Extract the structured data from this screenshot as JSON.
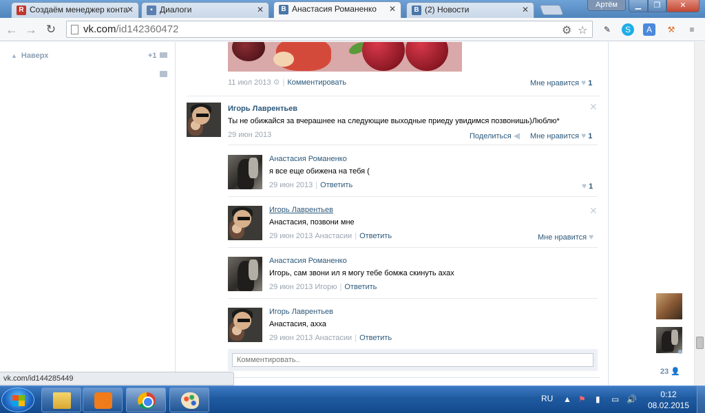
{
  "browser": {
    "tabs": [
      {
        "title": "Создаём менеджер конта",
        "icon": "R"
      },
      {
        "title": "Диалоги",
        "icon": ""
      },
      {
        "title": "Анастасия Романенко",
        "icon": "B"
      },
      {
        "title": "(2) Новости",
        "icon": "B"
      }
    ],
    "user": "Артём",
    "url_host": "vk.com",
    "url_path": "/id142360472",
    "status_url": "vk.com/id144285449"
  },
  "sidebar": {
    "go_up": "Наверх",
    "notif_count": "+1"
  },
  "post": {
    "date": "11 июл 2013",
    "comment_link": "Комментировать",
    "like_label": "Мне нравится",
    "like_count": "1"
  },
  "wall_post": {
    "author": "Игорь Лаврентьев",
    "text": "Ты не обижайся за вчерашнее на следующие выходные приеду увидимся позвонишь)Люблю*",
    "date": "29 июн 2013",
    "share_label": "Поделиться",
    "like_label": "Мне нравится",
    "like_count": "1"
  },
  "replies": [
    {
      "author": "Анастасия Романенко",
      "text": "я все еще обижена на тебя (",
      "date": "29 июн 2013",
      "reply_link": "Ответить",
      "like_count": "1"
    },
    {
      "author": "Игорь Лаврентьев",
      "text": "Анастасия, позвони мне",
      "date": "29 июн 2013 Анастасии",
      "reply_link": "Ответить",
      "like_label": "Мне нравится"
    },
    {
      "author": "Анастасия Романенко",
      "text": "Игорь, сам звони ил я могу тебе бомжа скинуть ахах",
      "date": "29 июн 2013 Игорю",
      "reply_link": "Ответить"
    },
    {
      "author": "Игорь Лаврентьев",
      "text": "Анастасия, ахха",
      "date": "29 июн 2013 Анастасии",
      "reply_link": "Ответить"
    }
  ],
  "comment_box": {
    "placeholder": "Комментировать.."
  },
  "friends": {
    "count": "23"
  },
  "taskbar": {
    "lang": "RU",
    "time": "0:12",
    "date": "08.02.2015"
  }
}
